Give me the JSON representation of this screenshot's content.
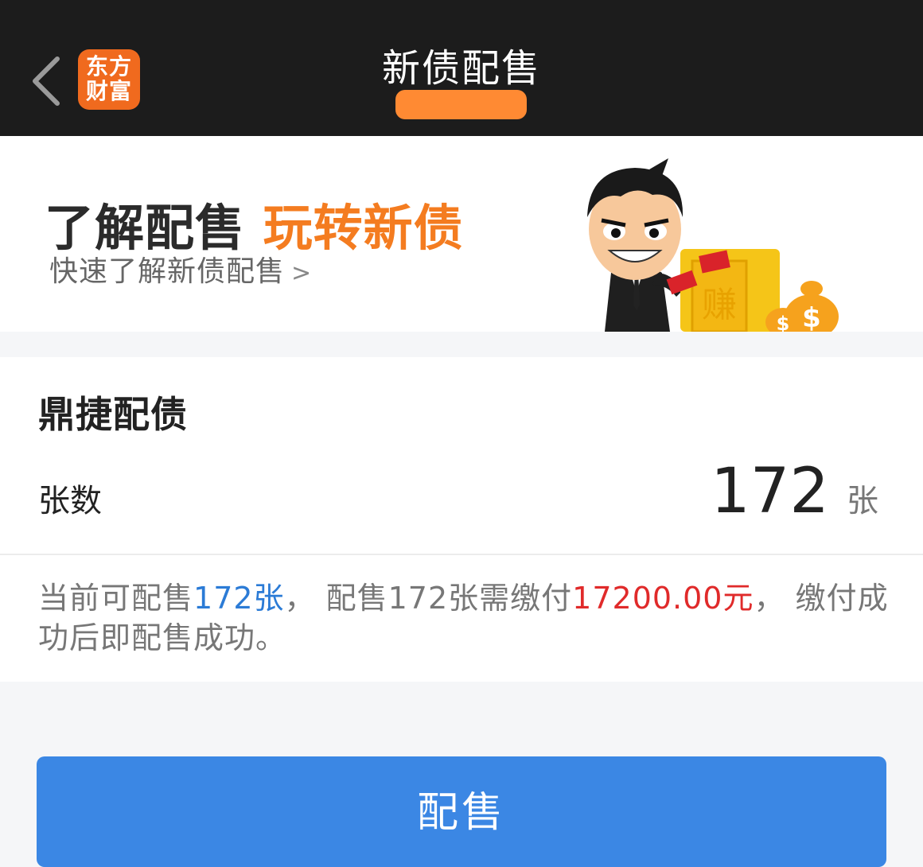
{
  "header": {
    "title": "新债配售",
    "logo_line1": "东方",
    "logo_line2": "财富"
  },
  "banner": {
    "head_main": "了解配售 ",
    "head_highlight": "玩转新债",
    "subtitle": "快速了解新债配售",
    "subtitle_chevron": ">",
    "safe_text": "赚"
  },
  "allotment": {
    "bond_name": "鼎捷配债",
    "quantity_label": "张数",
    "quantity_value": "172",
    "quantity_unit": "张",
    "note": {
      "part1": "当前可配售",
      "available": "172张",
      "part2": "， 配售172张需缴付",
      "amount": "17200.00元",
      "part3": "， 缴付成功后即配售成功。"
    }
  },
  "submit_label": "配售",
  "colors": {
    "header_bg": "#1c1c1c",
    "accent_orange": "#f47c20",
    "link_blue": "#2b7bd6",
    "amount_red": "#e02a2a",
    "button_blue": "#3b87e4"
  }
}
